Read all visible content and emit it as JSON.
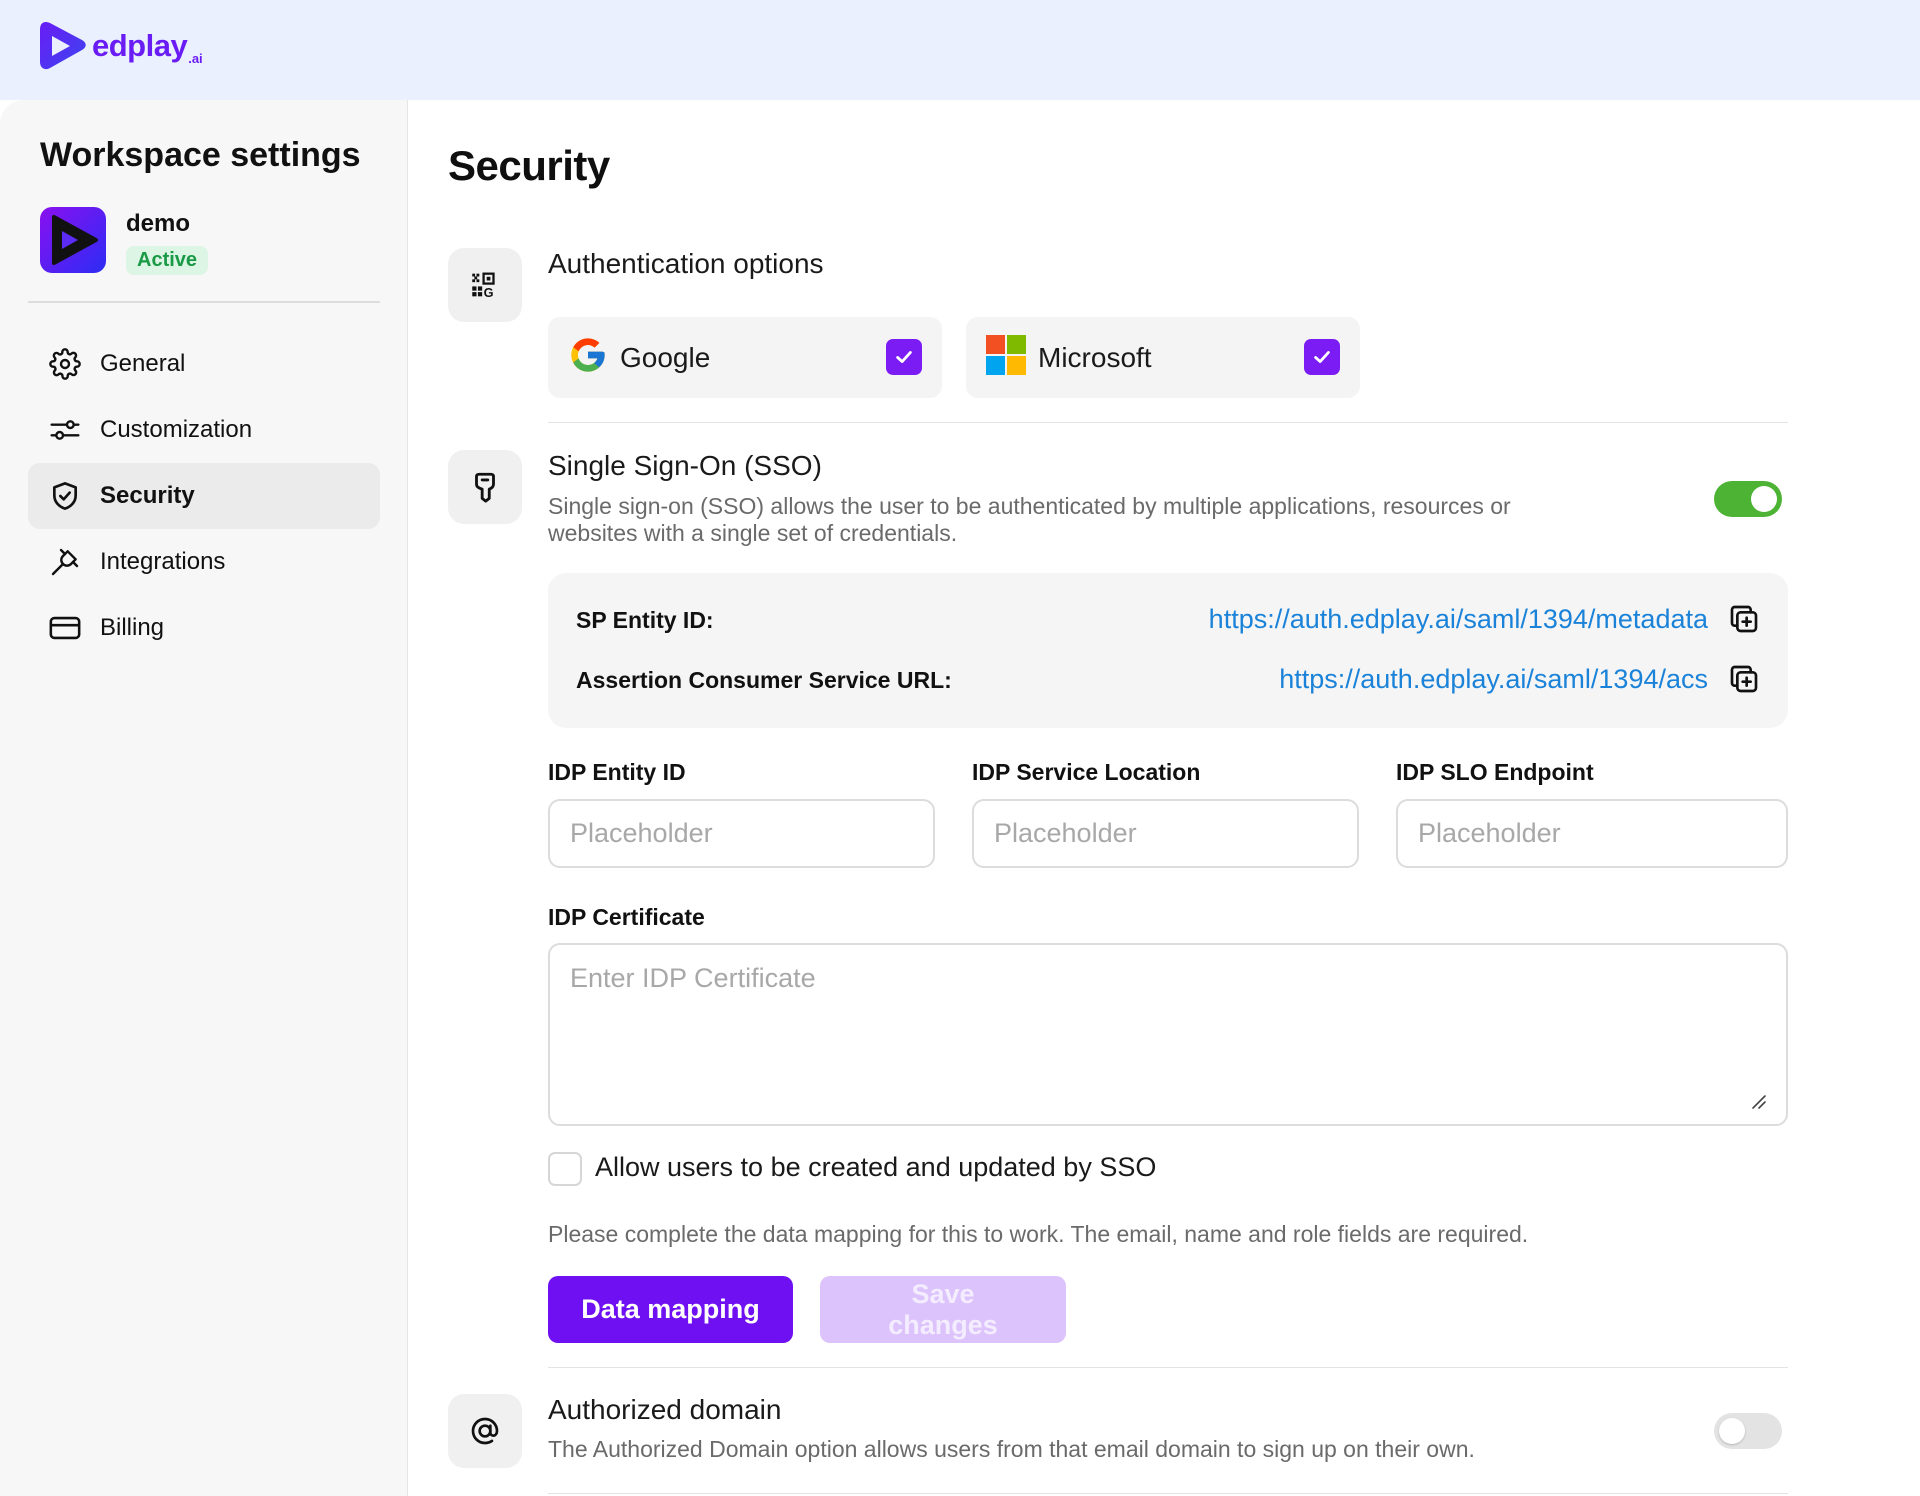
{
  "brand": {
    "name": "edplay",
    "suffix": ".ai"
  },
  "workspace": {
    "title": "Workspace settings",
    "name": "demo",
    "status": "Active"
  },
  "nav": {
    "items": [
      {
        "label": "General",
        "icon": "gear-icon"
      },
      {
        "label": "Customization",
        "icon": "sliders-icon"
      },
      {
        "label": "Security",
        "icon": "shield-check-icon",
        "active": true
      },
      {
        "label": "Integrations",
        "icon": "plug-icon"
      },
      {
        "label": "Billing",
        "icon": "credit-card-icon"
      }
    ]
  },
  "page": {
    "title": "Security"
  },
  "auth_options": {
    "title": "Authentication options",
    "providers": [
      {
        "label": "Google",
        "checked": true
      },
      {
        "label": "Microsoft",
        "checked": true
      }
    ]
  },
  "sso": {
    "title": "Single Sign-On (SSO)",
    "description_line1": "Single sign-on (SSO) allows the user to be authenticated by multiple applications, resources or",
    "description_line2": "websites with a single set of credentials.",
    "enabled": true,
    "sp_entity_label": "SP Entity ID:",
    "sp_entity_url": "https://auth.edplay.ai/saml/1394/metadata",
    "acs_label": "Assertion Consumer Service URL:",
    "acs_url": "https://auth.edplay.ai/saml/1394/acs",
    "fields": [
      {
        "label": "IDP Entity ID",
        "placeholder": "Placeholder"
      },
      {
        "label": "IDP Service Location",
        "placeholder": "Placeholder"
      },
      {
        "label": "IDP SLO Endpoint",
        "placeholder": "Placeholder"
      }
    ],
    "certificate_label": "IDP Certificate",
    "certificate_placeholder": "Enter IDP Certificate",
    "allow_users_label": "Allow users to be created and updated by SSO",
    "allow_users_checked": false,
    "mapping_note": "Please complete the data mapping for this to work. The email, name and role fields are required.",
    "data_mapping_button": "Data mapping",
    "save_button": "Save changes"
  },
  "authorized_domain": {
    "title": "Authorized domain",
    "description": "The Authorized Domain option allows users from that email domain to sign up on their own.",
    "enabled": false
  },
  "colors": {
    "accent": "#6f10f2",
    "toggle_on": "#4db335",
    "link": "#1a83d9",
    "topbar": "#eaf0fd"
  }
}
